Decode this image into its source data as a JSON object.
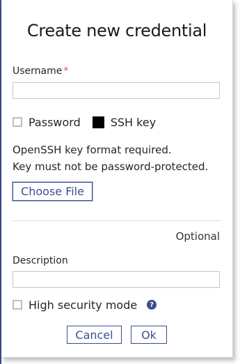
{
  "dialog": {
    "title": "Create new credential",
    "username": {
      "label": "Username",
      "required_marker": "*",
      "value": "",
      "placeholder": ""
    },
    "auth_type": {
      "options": [
        {
          "label": "Password",
          "selected": false
        },
        {
          "label": "SSH key",
          "selected": true
        }
      ]
    },
    "ssh_notes": [
      "OpenSSH key format required.",
      "Key must not be password-protected."
    ],
    "choose_file_label": "Choose File",
    "optional_label": "Optional",
    "description": {
      "label": "Description",
      "value": "",
      "placeholder": ""
    },
    "high_security": {
      "label": "High security mode",
      "checked": false,
      "help_icon": "question-circle-icon",
      "help_glyph": "?"
    },
    "cancel_label": "Cancel",
    "ok_label": "Ok"
  },
  "colors": {
    "accent": "#3d4c91",
    "required": "#d9534f",
    "border": "#c4c4c4",
    "text": "#262626"
  }
}
